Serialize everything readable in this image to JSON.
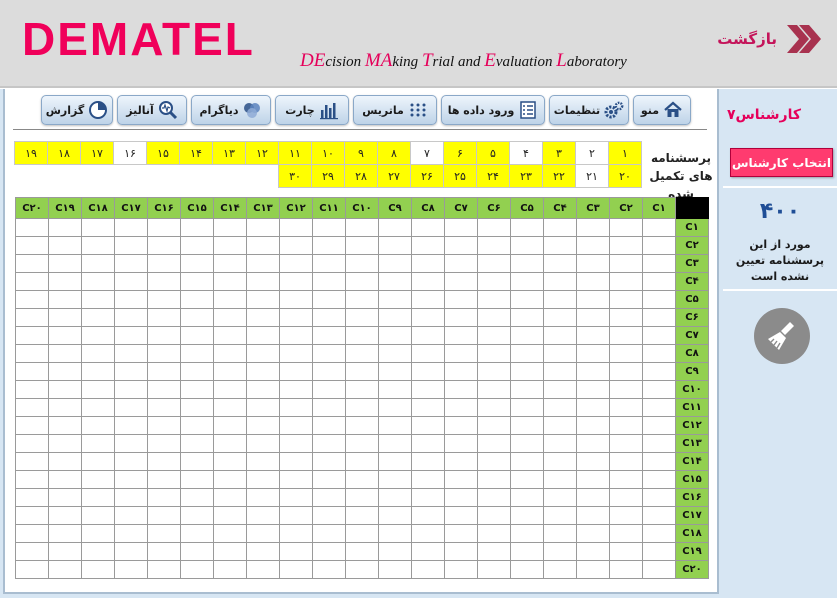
{
  "header": {
    "logo": "DEMATEL",
    "subtitle_parts": [
      {
        "text": "DE",
        "cap": true
      },
      {
        "text": "cision ",
        "cap": false
      },
      {
        "text": "MA",
        "cap": true
      },
      {
        "text": "king ",
        "cap": false
      },
      {
        "text": "T",
        "cap": true
      },
      {
        "text": "rial and ",
        "cap": false
      },
      {
        "text": "E",
        "cap": true
      },
      {
        "text": "valuation ",
        "cap": false
      },
      {
        "text": "L",
        "cap": true
      },
      {
        "text": "aboratory",
        "cap": false
      }
    ],
    "back_label": "بازگشت",
    "accent_color": "#e5005a"
  },
  "toolbar": {
    "buttons": [
      {
        "id": "menu",
        "label": "منو",
        "icon": "home-icon"
      },
      {
        "id": "settings",
        "label": "تنظیمات",
        "icon": "gears-icon"
      },
      {
        "id": "data-entry",
        "label": "ورود داده ها",
        "icon": "form-icon"
      },
      {
        "id": "matrix",
        "label": "ماتریس",
        "icon": "dots-icon"
      },
      {
        "id": "chart",
        "label": "چارت",
        "icon": "bar-chart-icon"
      },
      {
        "id": "diagram",
        "label": "دیاگرام",
        "icon": "venn-icon"
      },
      {
        "id": "analysis",
        "label": "آنالیز",
        "icon": "magnifier-icon"
      },
      {
        "id": "report",
        "label": "گزارش",
        "icon": "pie-chart-icon"
      }
    ]
  },
  "completed": {
    "label": "پرسشنامه های تکمیل شده",
    "row1": [
      {
        "label": "۱",
        "done": true
      },
      {
        "label": "۲",
        "done": false
      },
      {
        "label": "۳",
        "done": true
      },
      {
        "label": "۴",
        "done": false
      },
      {
        "label": "۵",
        "done": true
      },
      {
        "label": "۶",
        "done": true
      },
      {
        "label": "۷",
        "done": false
      },
      {
        "label": "۸",
        "done": true
      },
      {
        "label": "۹",
        "done": true
      },
      {
        "label": "۱۰",
        "done": true
      },
      {
        "label": "۱۱",
        "done": true
      },
      {
        "label": "۱۲",
        "done": true
      },
      {
        "label": "۱۳",
        "done": true
      },
      {
        "label": "۱۴",
        "done": true
      },
      {
        "label": "۱۵",
        "done": true
      },
      {
        "label": "۱۶",
        "done": false
      },
      {
        "label": "۱۷",
        "done": true
      },
      {
        "label": "۱۸",
        "done": true
      },
      {
        "label": "۱۹",
        "done": true
      }
    ],
    "row2": [
      {
        "label": "۲۰",
        "done": true
      },
      {
        "label": "۲۱",
        "done": false
      },
      {
        "label": "۲۲",
        "done": true
      },
      {
        "label": "۲۳",
        "done": true
      },
      {
        "label": "۲۴",
        "done": true
      },
      {
        "label": "۲۵",
        "done": true
      },
      {
        "label": "۲۶",
        "done": true
      },
      {
        "label": "۲۷",
        "done": true
      },
      {
        "label": "۲۸",
        "done": true
      },
      {
        "label": "۲۹",
        "done": true
      },
      {
        "label": "۳۰",
        "done": true
      }
    ]
  },
  "matrix": {
    "columns": [
      "C۱",
      "C۲",
      "C۳",
      "C۴",
      "C۵",
      "C۶",
      "C۷",
      "C۸",
      "C۹",
      "C۱۰",
      "C۱۱",
      "C۱۲",
      "C۱۳",
      "C۱۴",
      "C۱۵",
      "C۱۶",
      "C۱۷",
      "C۱۸",
      "C۱۹",
      "C۲۰"
    ],
    "rows": [
      "C۱",
      "C۲",
      "C۳",
      "C۴",
      "C۵",
      "C۶",
      "C۷",
      "C۸",
      "C۹",
      "C۱۰",
      "C۱۱",
      "C۱۲",
      "C۱۳",
      "C۱۴",
      "C۱۵",
      "C۱۶",
      "C۱۷",
      "C۱۸",
      "C۱۹",
      "C۲۰"
    ],
    "header_color": "#92d050"
  },
  "right_panel": {
    "expert_label": "کارشناس",
    "expert_number": "۷",
    "choose_expert_label": "انتخاب کارشناس",
    "count_value": "۴۰۰",
    "count_desc": "مورد از این پرسشنامه تعیین نشده است",
    "clear_icon": "broom-icon"
  }
}
